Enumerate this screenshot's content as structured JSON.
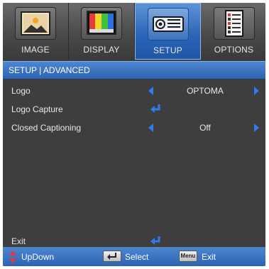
{
  "tabs": [
    {
      "label": "IMAGE",
      "icon": "image-icon",
      "active": false
    },
    {
      "label": "DISPLAY",
      "icon": "display-icon",
      "active": false
    },
    {
      "label": "SETUP",
      "icon": "projector-icon",
      "active": true
    },
    {
      "label": "OPTIONS",
      "icon": "options-list-icon",
      "active": false
    }
  ],
  "title": "SETUP | ADVANCED",
  "menu": {
    "logo": {
      "label": "Logo",
      "value": "OPTOMA"
    },
    "logo_capture": {
      "label": "Logo Capture"
    },
    "closed_captioning": {
      "label": "Closed Captioning",
      "value": "Off"
    },
    "exit": {
      "label": "Exit"
    }
  },
  "footer": {
    "updown": "UpDown",
    "select": "Select",
    "menu_key": "Menu",
    "exit": "Exit"
  },
  "colors": {
    "accent": "#2b64b5",
    "arrow": "#2f7cf0",
    "updown_arrow": "#e03a3a",
    "background": "#3e3e3e"
  }
}
